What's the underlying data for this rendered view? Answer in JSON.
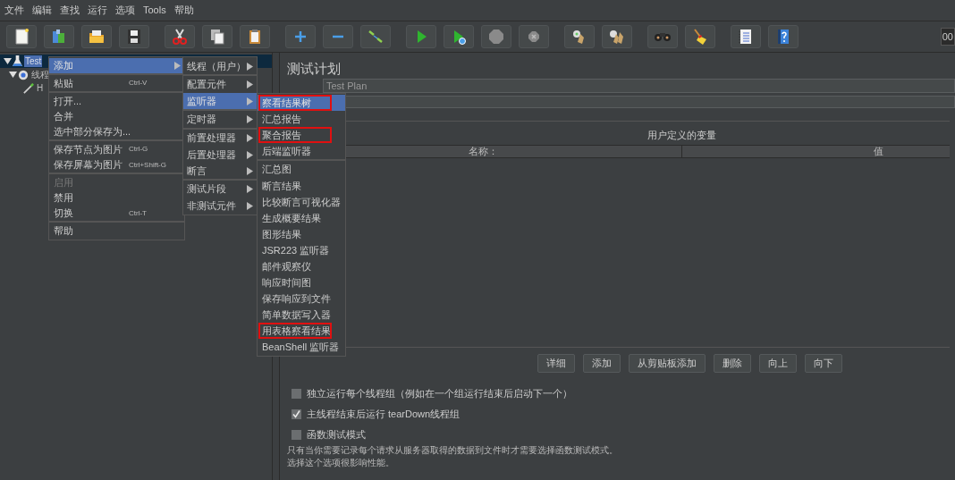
{
  "menu_bar": [
    {
      "label": "文件"
    },
    {
      "label": "编辑"
    },
    {
      "label": "查找"
    },
    {
      "label": "运行"
    },
    {
      "label": "选项"
    },
    {
      "label": "Tools"
    },
    {
      "label": "帮助"
    }
  ],
  "toolbar": {
    "clock": "00"
  },
  "tree": [
    {
      "label": "Test",
      "selected": true,
      "expanded": true,
      "kind": "plan",
      "children": [
        {
          "label": "线程",
          "selected": false,
          "expanded": true,
          "kind": "group",
          "children": [
            {
              "label": "H",
              "selected": false,
              "kind": "sampler"
            }
          ]
        }
      ]
    }
  ],
  "context_menu": [
    {
      "label": "添加",
      "submenu": true,
      "selected": true,
      "disabled": false,
      "separator_before": false
    },
    {
      "label": "粘贴",
      "shortcut": "Ctrl-V",
      "submenu": false,
      "selected": false,
      "disabled": false,
      "separator_before": true
    },
    {
      "label": "打开...",
      "submenu": false,
      "selected": false,
      "disabled": false,
      "separator_before": true
    },
    {
      "label": "合并",
      "submenu": false,
      "selected": false,
      "disabled": false,
      "separator_before": false
    },
    {
      "label": "选中部分保存为...",
      "submenu": false,
      "selected": false,
      "disabled": false,
      "separator_before": false
    },
    {
      "label": "保存节点为图片",
      "shortcut": "Ctrl-G",
      "submenu": false,
      "selected": false,
      "disabled": false,
      "separator_before": true
    },
    {
      "label": "保存屏幕为图片",
      "shortcut": "Ctrl+Shift-G",
      "submenu": false,
      "selected": false,
      "disabled": false,
      "separator_before": false
    },
    {
      "label": "启用",
      "submenu": false,
      "selected": false,
      "disabled": true,
      "separator_before": true
    },
    {
      "label": "禁用",
      "submenu": false,
      "selected": false,
      "disabled": false,
      "separator_before": false
    },
    {
      "label": "切换",
      "shortcut": "Ctrl-T",
      "submenu": false,
      "selected": false,
      "disabled": false,
      "separator_before": false
    },
    {
      "label": "帮助",
      "submenu": false,
      "selected": false,
      "disabled": false,
      "separator_before": true
    }
  ],
  "add_submenu": [
    {
      "label": "线程（用户）",
      "selected": false,
      "separator_before": false
    },
    {
      "label": "配置元件",
      "selected": false,
      "separator_before": true
    },
    {
      "label": "监听器",
      "selected": true,
      "separator_before": false
    },
    {
      "label": "定时器",
      "selected": false,
      "separator_before": true
    },
    {
      "label": "前置处理器",
      "selected": false,
      "separator_before": true
    },
    {
      "label": "后置处理器",
      "selected": false,
      "separator_before": false
    },
    {
      "label": "断言",
      "selected": false,
      "separator_before": false
    },
    {
      "label": "测试片段",
      "selected": false,
      "separator_before": true
    },
    {
      "label": "非测试元件",
      "selected": false,
      "separator_before": false
    }
  ],
  "listener_submenu": [
    {
      "label": "察看结果树",
      "selected": true,
      "highlighted": true,
      "separator_before": false
    },
    {
      "label": "汇总报告",
      "selected": false,
      "highlighted": false,
      "separator_before": false
    },
    {
      "label": "聚合报告",
      "selected": false,
      "highlighted": true,
      "separator_before": false
    },
    {
      "label": "后端监听器",
      "selected": false,
      "highlighted": false,
      "separator_before": false
    },
    {
      "label": "汇总图",
      "selected": false,
      "highlighted": false,
      "separator_before": true
    },
    {
      "label": "断言结果",
      "selected": false,
      "highlighted": false,
      "separator_before": false
    },
    {
      "label": "比较断言可视化器",
      "selected": false,
      "highlighted": false,
      "separator_before": false
    },
    {
      "label": "生成概要结果",
      "selected": false,
      "highlighted": false,
      "separator_before": false
    },
    {
      "label": "图形结果",
      "selected": false,
      "highlighted": false,
      "separator_before": false
    },
    {
      "label": "JSR223 监听器",
      "selected": false,
      "highlighted": false,
      "separator_before": false
    },
    {
      "label": "邮件观察仪",
      "selected": false,
      "highlighted": false,
      "separator_before": false
    },
    {
      "label": "响应时间图",
      "selected": false,
      "highlighted": false,
      "separator_before": false
    },
    {
      "label": "保存响应到文件",
      "selected": false,
      "highlighted": false,
      "separator_before": false
    },
    {
      "label": "简单数据写入器",
      "selected": false,
      "highlighted": false,
      "separator_before": false
    },
    {
      "label": "用表格察看结果",
      "selected": false,
      "highlighted": true,
      "separator_before": false
    },
    {
      "label": "BeanShell 监听器",
      "selected": false,
      "highlighted": false,
      "separator_before": false
    }
  ],
  "test_plan": {
    "title": "测试计划",
    "name_value": "Test Plan",
    "variables": {
      "title": "用户定义的变量",
      "columns": [
        "名称：",
        "值"
      ]
    },
    "buttons": [
      "详细",
      "添加",
      "从剪贴板添加",
      "删除",
      "向上",
      "向下"
    ],
    "options": [
      {
        "label": "独立运行每个线程组（例如在一个组运行结束后启动下一个）",
        "checked": false
      },
      {
        "label": "主线程结束后运行 tearDown线程组",
        "checked": true
      },
      {
        "label": "函数测试模式",
        "checked": false
      }
    ],
    "note": [
      "只有当你需要记录每个请求从服务器取得的数据到文件时才需要选择函数测试模式。",
      "选择这个选项很影响性能。"
    ]
  }
}
